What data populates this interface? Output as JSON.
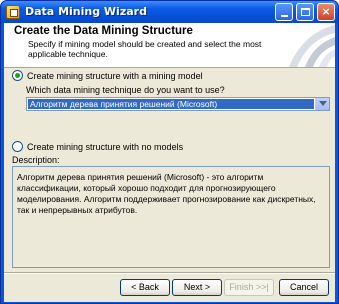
{
  "window": {
    "title": "Data Mining Wizard",
    "controls": {
      "minimize": "minimize-icon",
      "maximize": "maximize-icon",
      "close": "×"
    }
  },
  "header": {
    "title": "Create the Data Mining Structure",
    "subtitle": "Specify if mining model should be created and select the most applicable technique."
  },
  "options": {
    "with_model": {
      "label": "Create mining structure with a mining  model",
      "selected": true
    },
    "question": "Which data mining technique do you want to use?",
    "technique": {
      "value": "Алгоритм дерева принятия решений (Microsoft)"
    },
    "no_models": {
      "label": "Create mining structure with no models",
      "selected": false
    }
  },
  "description": {
    "label": "Description:",
    "text": "Алгоритм дерева принятия решений (Microsoft) - это алгоритм классификации, который хорошо подходит для прогнозирующего моделирования. Алгоритм поддерживает прогнозирование как дискретных, так и непрерывных атрибутов."
  },
  "buttons": {
    "back": "< Back",
    "next": "Next >",
    "finish": "Finish >>|",
    "cancel": "Cancel"
  },
  "colors": {
    "titlebar": "#0a56d8",
    "selection": "#316ac5",
    "radio_dot": "#21a121",
    "dialog_bg": "#ece9d8"
  }
}
